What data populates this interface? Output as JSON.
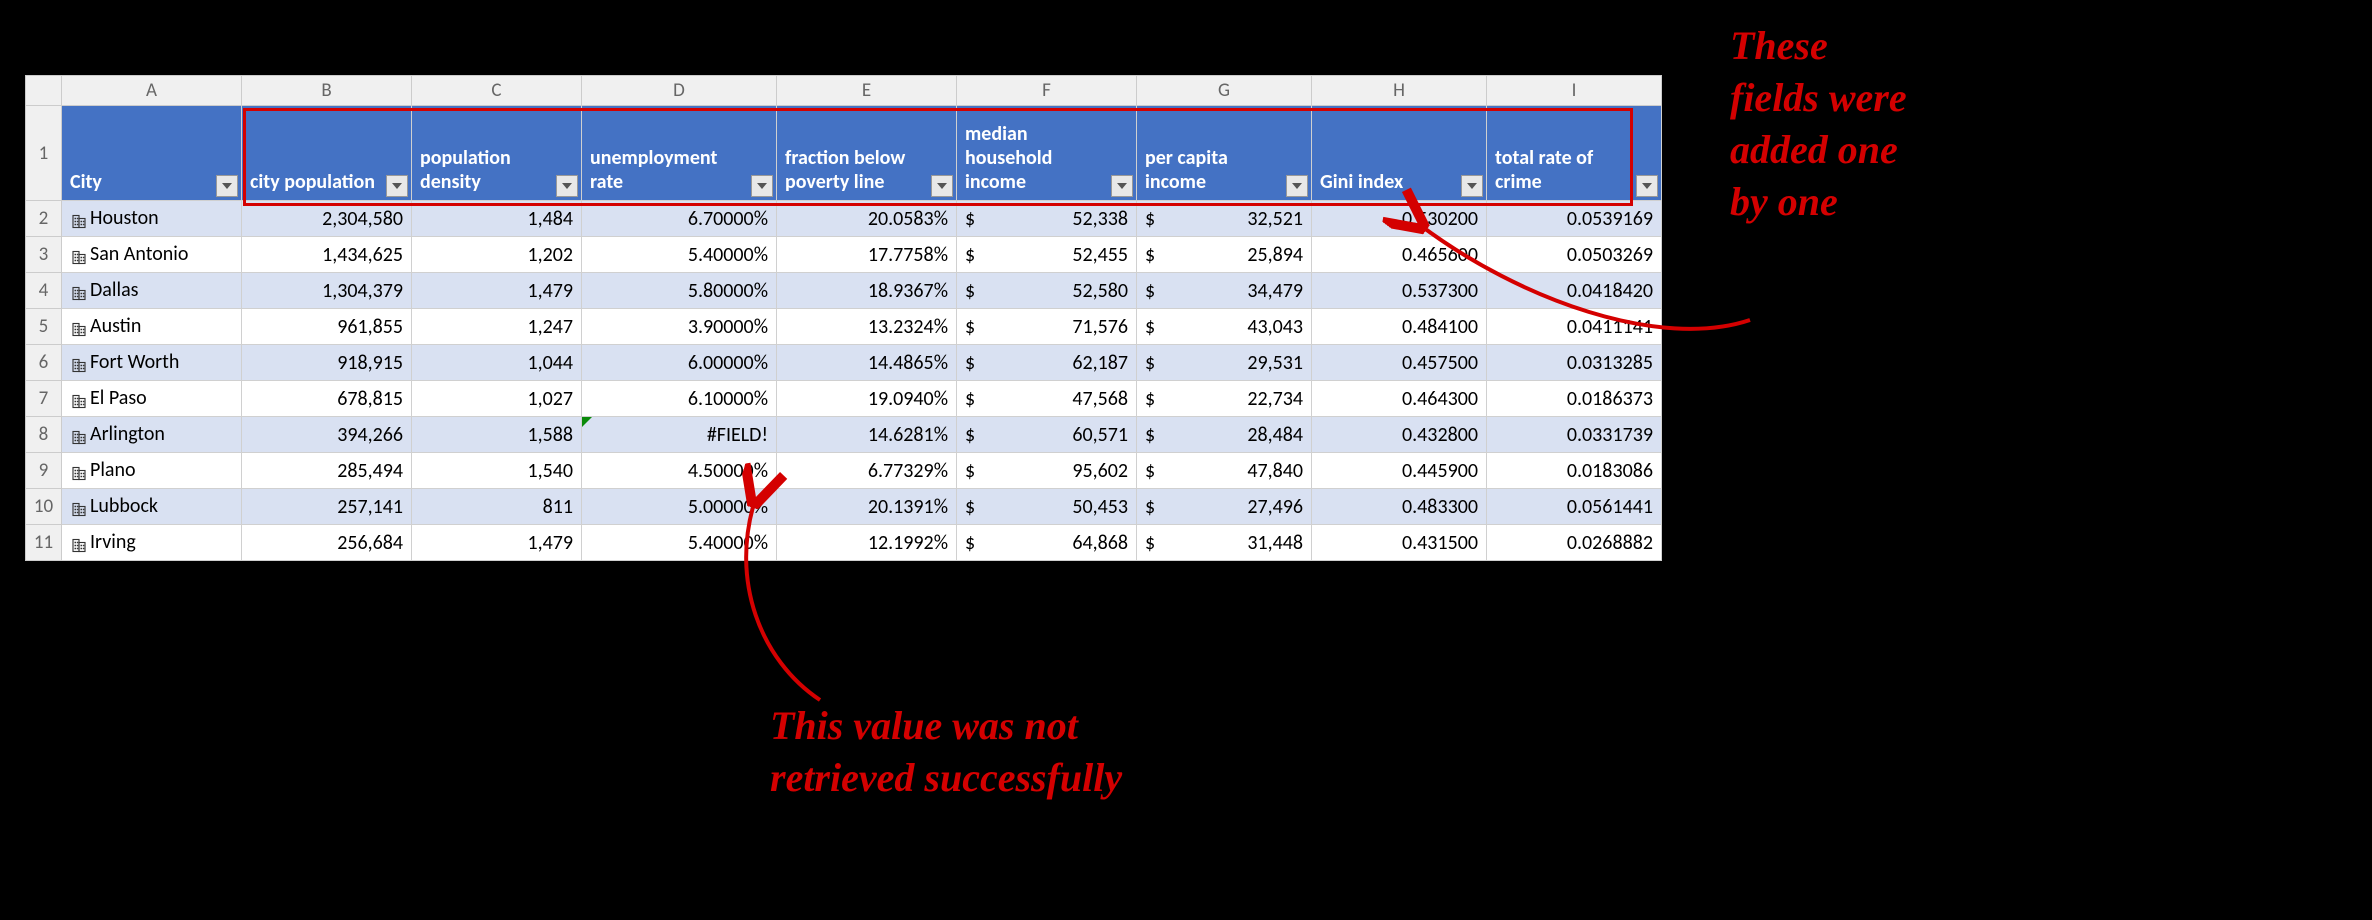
{
  "columns": [
    "A",
    "B",
    "C",
    "D",
    "E",
    "F",
    "G",
    "H",
    "I"
  ],
  "headers": {
    "A": "City",
    "B": "city population",
    "C": "population density",
    "D": "unemployment rate",
    "E": "fraction below poverty line",
    "F": "median household income",
    "G": "per capita income",
    "H": "Gini index",
    "I": "total rate of crime"
  },
  "rows": [
    {
      "n": "2",
      "city": "Houston",
      "pop": "2,304,580",
      "dens": "1,484",
      "unemp": "6.70000%",
      "pov": "20.0583%",
      "mhi": "52,338",
      "pci": "32,521",
      "gini": "0.530200",
      "crime": "0.0539169"
    },
    {
      "n": "3",
      "city": "San Antonio",
      "pop": "1,434,625",
      "dens": "1,202",
      "unemp": "5.40000%",
      "pov": "17.7758%",
      "mhi": "52,455",
      "pci": "25,894",
      "gini": "0.465600",
      "crime": "0.0503269"
    },
    {
      "n": "4",
      "city": "Dallas",
      "pop": "1,304,379",
      "dens": "1,479",
      "unemp": "5.80000%",
      "pov": "18.9367%",
      "mhi": "52,580",
      "pci": "34,479",
      "gini": "0.537300",
      "crime": "0.0418420"
    },
    {
      "n": "5",
      "city": "Austin",
      "pop": "961,855",
      "dens": "1,247",
      "unemp": "3.90000%",
      "pov": "13.2324%",
      "mhi": "71,576",
      "pci": "43,043",
      "gini": "0.484100",
      "crime": "0.0411141"
    },
    {
      "n": "6",
      "city": "Fort Worth",
      "pop": "918,915",
      "dens": "1,044",
      "unemp": "6.00000%",
      "pov": "14.4865%",
      "mhi": "62,187",
      "pci": "29,531",
      "gini": "0.457500",
      "crime": "0.0313285"
    },
    {
      "n": "7",
      "city": "El Paso",
      "pop": "678,815",
      "dens": "1,027",
      "unemp": "6.10000%",
      "pov": "19.0940%",
      "mhi": "47,568",
      "pci": "22,734",
      "gini": "0.464300",
      "crime": "0.0186373"
    },
    {
      "n": "8",
      "city": "Arlington",
      "pop": "394,266",
      "dens": "1,588",
      "unemp": "#FIELD!",
      "pov": "14.6281%",
      "mhi": "60,571",
      "pci": "28,484",
      "gini": "0.432800",
      "crime": "0.0331739"
    },
    {
      "n": "9",
      "city": "Plano",
      "pop": "285,494",
      "dens": "1,540",
      "unemp": "4.50000%",
      "pov": "6.77329%",
      "mhi": "95,602",
      "pci": "47,840",
      "gini": "0.445900",
      "crime": "0.0183086"
    },
    {
      "n": "10",
      "city": "Lubbock",
      "pop": "257,141",
      "dens": "811",
      "unemp": "5.00000%",
      "pov": "20.1391%",
      "mhi": "50,453",
      "pci": "27,496",
      "gini": "0.483300",
      "crime": "0.0561441"
    },
    {
      "n": "11",
      "city": "Irving",
      "pop": "256,684",
      "dens": "1,479",
      "unemp": "5.40000%",
      "pov": "12.1992%",
      "mhi": "64,868",
      "pci": "31,448",
      "gini": "0.431500",
      "crime": "0.0268882"
    }
  ],
  "currency_symbol": "$",
  "error_cell": {
    "row": "8",
    "col": "D"
  },
  "annotations": {
    "top_right": "These\nfields were\nadded one\nby one",
    "bottom": "This value was not\nretrieved successfully"
  }
}
